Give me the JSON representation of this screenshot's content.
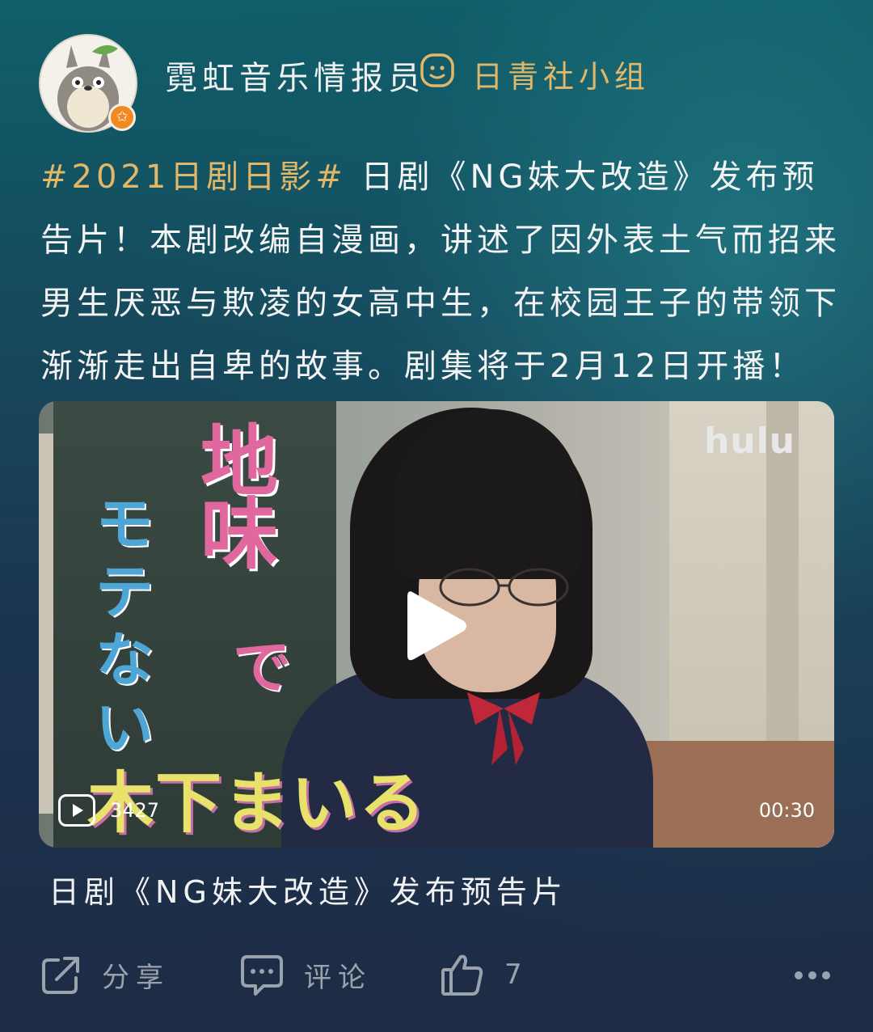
{
  "author": {
    "name": "霓虹音乐情报员",
    "group_name": "日青社小组"
  },
  "post": {
    "hashtag": "#2021日剧日影#",
    "text": " 日剧《NG妹大改造》发布预告片！本剧改编自漫画，讲述了因外表土气而招来男生厌恶与欺凌的女高中生，在校园王子的带领下渐渐走出自卑的故事。剧集将于2月12日开播！"
  },
  "video": {
    "overlay_title_1": "地味",
    "overlay_title_2": "モテない",
    "overlay_title_2b": "で",
    "overlay_name": "木下まいる",
    "watermark": "hulu",
    "play_count": "3427",
    "duration": "00:30",
    "caption": "日剧《NG妹大改造》发布预告片"
  },
  "actions": {
    "share_label": "分享",
    "comment_label": "评论",
    "like_count": "7"
  },
  "colors": {
    "accent": "#e2b768",
    "muted": "#9aa3ac",
    "badge": "#f08a1e"
  }
}
